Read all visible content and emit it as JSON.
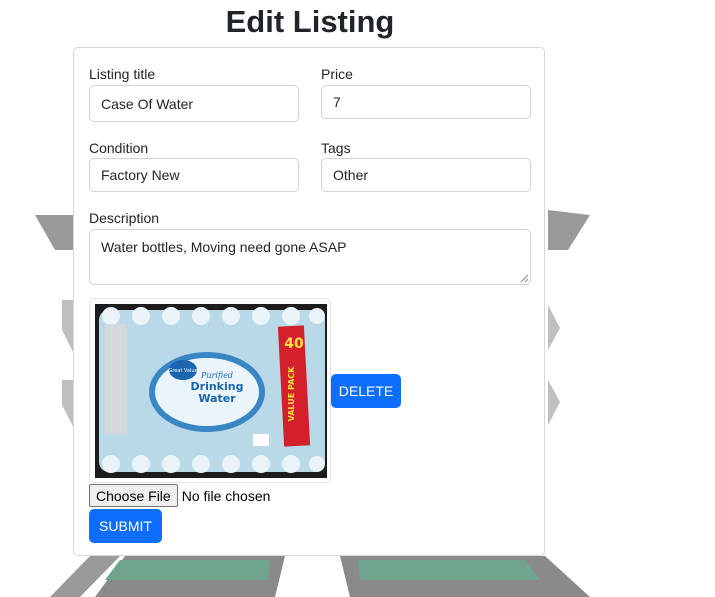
{
  "page": {
    "title": "Edit Listing"
  },
  "form": {
    "title_label": "Listing title",
    "title_value": "Case Of Water",
    "price_label": "Price",
    "price_value": "7",
    "condition_label": "Condition",
    "condition_value": "Factory New",
    "tags_label": "Tags",
    "tags_value": "Other",
    "description_label": "Description",
    "description_value": "Water bottles, Moving need gone ASAP",
    "delete_label": "DELETE",
    "file_button_label": "Choose File",
    "file_status": "No file chosen",
    "submit_label": "SUBMIT"
  },
  "product_image": {
    "brand": "Great Value",
    "label_line1": "Purified",
    "label_line2": "Drinking",
    "label_line3": "Water",
    "badge_count": "40",
    "badge_text": "VALUE PACK"
  },
  "colors": {
    "primary": "#0d6efd",
    "border": "#ced4da",
    "emblem_gray": "#8e8e8e",
    "emblem_green": "#6fa58f"
  }
}
